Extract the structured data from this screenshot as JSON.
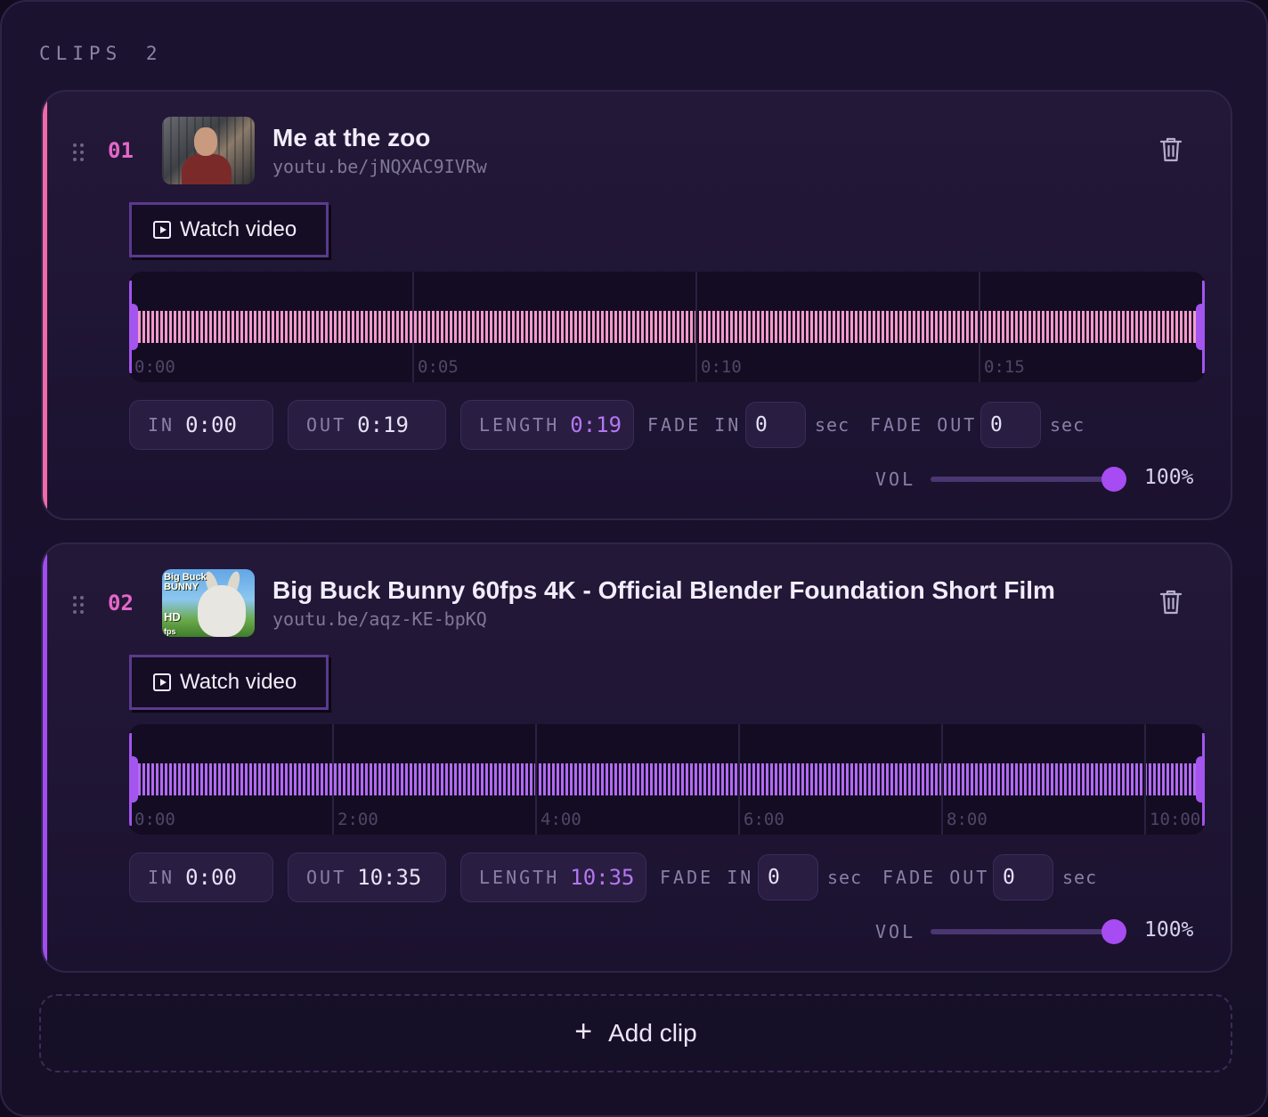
{
  "section": {
    "label": "CLIPS",
    "count": "2"
  },
  "colors": {
    "clip1_accent": "#f06aa9",
    "clip2_accent": "#a14cf0",
    "knob": "#a64cf2"
  },
  "clips": [
    {
      "number": "01",
      "title": "Me at the zoo",
      "url": "youtu.be/jNQXAC9IVRw",
      "watch_label": "Watch video",
      "ticks": [
        "0:00",
        "0:05",
        "0:10",
        "0:15"
      ],
      "in_label": "IN",
      "in_value": "0:00",
      "out_label": "OUT",
      "out_value": "0:19",
      "length_label": "LENGTH",
      "length_value": "0:19",
      "fade_in_label": "FADE IN",
      "fade_in_value": "0",
      "fade_in_unit": "sec",
      "fade_out_label": "FADE OUT",
      "fade_out_value": "0",
      "fade_out_unit": "sec",
      "vol_label": "VOL",
      "vol_value": "100%",
      "vol_level": 1.0
    },
    {
      "number": "02",
      "title": "Big Buck Bunny 60fps 4K - Official Blender Foundation Short Film",
      "url": "youtu.be/aqz-KE-bpKQ",
      "watch_label": "Watch video",
      "thumb_logo": "Big Buck BUNNY",
      "thumb_badge": "HD",
      "thumb_fps": "fps",
      "ticks": [
        "0:00",
        "2:00",
        "4:00",
        "6:00",
        "8:00",
        "10:00"
      ],
      "in_label": "IN",
      "in_value": "0:00",
      "out_label": "OUT",
      "out_value": "10:35",
      "length_label": "LENGTH",
      "length_value": "10:35",
      "fade_in_label": "FADE IN",
      "fade_in_value": "0",
      "fade_in_unit": "sec",
      "fade_out_label": "FADE OUT",
      "fade_out_value": "0",
      "fade_out_unit": "sec",
      "vol_label": "VOL",
      "vol_value": "100%",
      "vol_level": 1.0
    }
  ],
  "add_clip": {
    "icon": "plus-icon",
    "label": "Add clip"
  }
}
